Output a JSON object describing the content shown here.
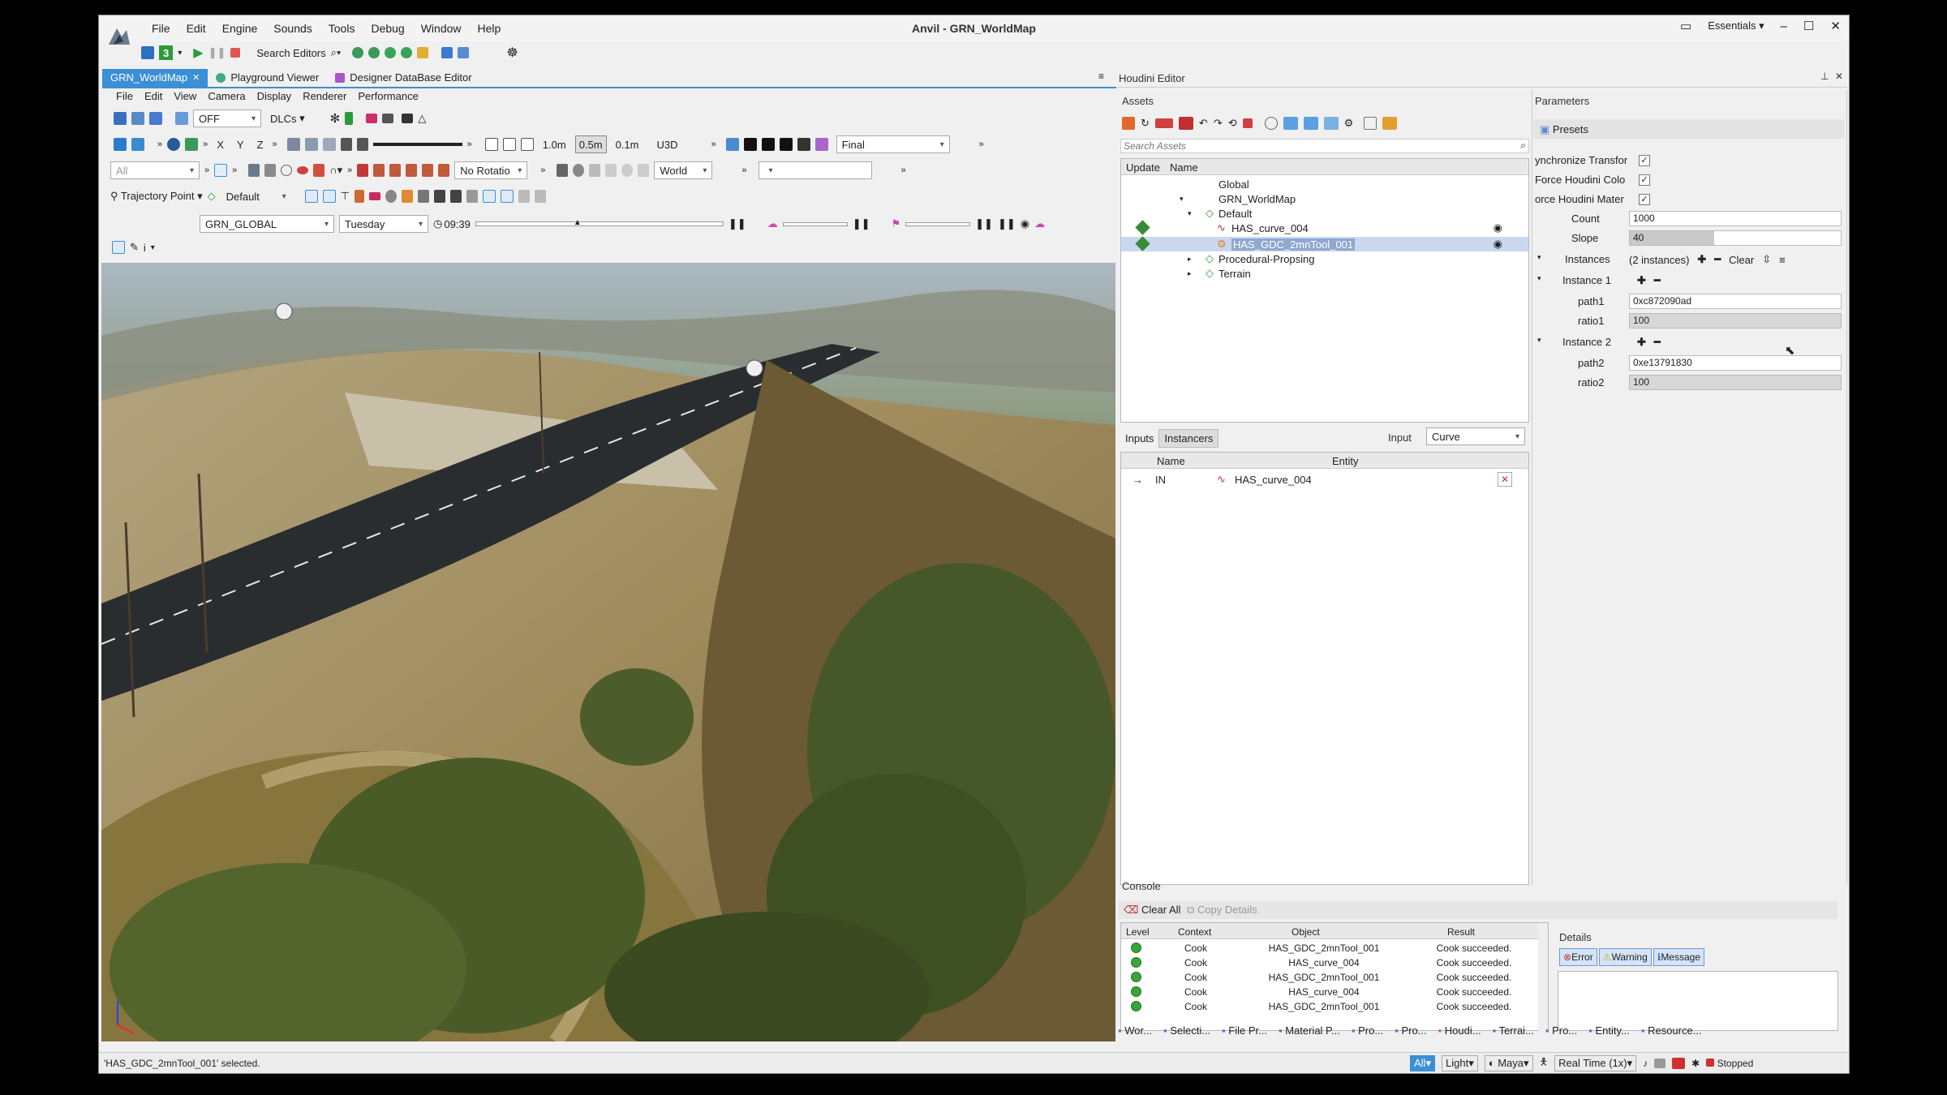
{
  "app": {
    "title": "Anvil - GRN_WorldMap",
    "menu": [
      "File",
      "Edit",
      "Engine",
      "Sounds",
      "Tools",
      "Debug",
      "Window",
      "Help"
    ],
    "workspace": "Essentials",
    "toolbar": {
      "badge": "3",
      "search_label": "Search Editors"
    }
  },
  "doc_tabs": [
    {
      "label": "GRN_WorldMap",
      "active": true
    },
    {
      "label": "Playground Viewer",
      "active": false
    },
    {
      "label": "Designer DataBase Editor",
      "active": false
    }
  ],
  "viewport": {
    "menu": [
      "File",
      "Edit",
      "View",
      "Camera",
      "Display",
      "Renderer",
      "Performance"
    ],
    "toggle_value": "OFF",
    "dlcs": "DLCs",
    "axes": [
      "X",
      "Y",
      "Z"
    ],
    "snap_sizes": [
      "1.0m",
      "0.5m",
      "0.1m"
    ],
    "u3d": "U3D",
    "render_mode": "Final",
    "all_label": "All",
    "rotation_mode": "No Rotatio",
    "space": "World",
    "trajectory_label": "Trajectory Point",
    "layer": "Default",
    "scene": "GRN_GLOBAL",
    "day": "Tuesday",
    "time": "09:39"
  },
  "houdini": {
    "title": "Houdini Editor",
    "assets_label": "Assets",
    "search_placeholder": "Search Assets",
    "columns": [
      "Update",
      "Name"
    ],
    "tree": [
      {
        "label": "Global",
        "indent": 0
      },
      {
        "label": "GRN_WorldMap",
        "indent": 0
      },
      {
        "label": "Default",
        "indent": 1
      },
      {
        "label": "HAS_curve_004",
        "indent": 2
      },
      {
        "label": "HAS_GDC_2mnTool_001",
        "indent": 2
      },
      {
        "label": "Procedural-Propsing",
        "indent": 1
      },
      {
        "label": "Terrain",
        "indent": 1
      }
    ],
    "inputs_tabs": [
      "Inputs",
      "Instancers"
    ],
    "input_label": "Input",
    "input_value": "Curve",
    "input_columns": [
      "Name",
      "Entity"
    ],
    "input_rows": [
      {
        "name": "IN",
        "entity": "HAS_curve_004"
      }
    ]
  },
  "parameters": {
    "title": "Parameters",
    "presets": "Presets",
    "checks": [
      {
        "label": "ynchronize Transfor",
        "checked": true
      },
      {
        "label": "Force Houdini Colo",
        "checked": true
      },
      {
        "label": "orce Houdini Mater",
        "checked": true
      }
    ],
    "count_label": "Count",
    "count_value": "1000",
    "slope_label": "Slope",
    "slope_value": "40",
    "slope_fill": 0.4,
    "instances_label": "Instances",
    "instances_value": "(2 instances)",
    "clear_label": "Clear",
    "instance1": {
      "label": "Instance 1",
      "path_label": "path1",
      "path": "0xc872090ad",
      "ratio_label": "ratio1",
      "ratio": "100"
    },
    "instance2": {
      "label": "Instance 2",
      "path_label": "path2",
      "path": "0xe13791830",
      "ratio_label": "ratio2",
      "ratio": "100"
    }
  },
  "console": {
    "title": "Console",
    "clear_all": "Clear All",
    "copy_details": "Copy Details",
    "columns": [
      "Level",
      "Context",
      "Object",
      "Result"
    ],
    "rows": [
      {
        "context": "Cook",
        "object": "HAS_GDC_2mnTool_001",
        "result": "Cook succeeded."
      },
      {
        "context": "Cook",
        "object": "HAS_curve_004",
        "result": "Cook succeeded."
      },
      {
        "context": "Cook",
        "object": "HAS_GDC_2mnTool_001",
        "result": "Cook succeeded."
      },
      {
        "context": "Cook",
        "object": "HAS_curve_004",
        "result": "Cook succeeded."
      },
      {
        "context": "Cook",
        "object": "HAS_GDC_2mnTool_001",
        "result": "Cook succeeded."
      }
    ],
    "details_title": "Details",
    "filters": [
      "Error",
      "Warning",
      "Message"
    ]
  },
  "bottom_tabs": [
    "Wor...",
    "Selecti...",
    "File Pr...",
    "Material P...",
    "Pro...",
    "Pro...",
    "Houdi...",
    "Terrai...",
    "Pro...",
    "Entity...",
    "Resource..."
  ],
  "status": {
    "message": "'HAS_GDC_2mnTool_001' selected.",
    "filter": "All",
    "light": "Light",
    "maya": "Maya",
    "realtime": "Real Time (1x)",
    "state": "Stopped"
  }
}
